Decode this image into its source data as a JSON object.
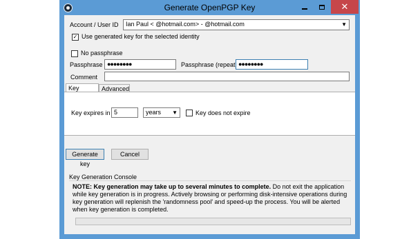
{
  "window": {
    "title": "Generate OpenPGP Key",
    "close_glyph": "✕"
  },
  "identity": {
    "label": "Account / User ID",
    "value": "Ian Paul <              @hotmail.com> -          @hotmail.com",
    "use_generated_label": "Use generated key for the selected identity",
    "use_generated_checked": true
  },
  "passphrase": {
    "no_passphrase_label": "No passphrase",
    "no_passphrase_checked": false,
    "label": "Passphrase",
    "value": "●●●●●●●●",
    "repeat_label": "Passphrase (repeat)",
    "repeat_value": "●●●●●●●●",
    "comment_label": "Comment",
    "comment_value": ""
  },
  "tabs": [
    {
      "label": "Key expiry",
      "active": true
    },
    {
      "label": "Advanced",
      "active": false
    }
  ],
  "expiry": {
    "label": "Key expires in",
    "amount": "5",
    "unit": "years",
    "no_expire_label": "Key does not expire",
    "no_expire_checked": false
  },
  "buttons": {
    "generate": "Generate key",
    "cancel": "Cancel"
  },
  "console": {
    "title": "Key Generation Console",
    "note_bold": "NOTE: Key generation may take up to several minutes to complete.",
    "note_text": " Do not exit the application while key generation is in progress. Actively browsing or performing disk-intensive operations during key generation will replenish the 'randomness pool' and speed-up the process. You will be alerted when key generation is completed."
  },
  "progress": {
    "value": 0
  },
  "colors": {
    "frame": "#5b9bd5",
    "close": "#c6464a",
    "focus": "#3c7fb1"
  },
  "icons": {
    "app": "openpgp-app-icon",
    "minimize": "minimize-icon",
    "maximize": "maximize-icon",
    "close": "close-icon",
    "dropdown": "chevron-down-icon"
  }
}
